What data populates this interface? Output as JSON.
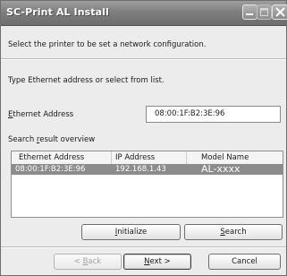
{
  "window": {
    "title": "SC-Print AL Install"
  },
  "titlebar_buttons": {
    "minimize_icon": "minimize-icon",
    "maximize_icon": "maximize-icon",
    "close_icon": "close-icon"
  },
  "instructions": {
    "line1": "Select the printer to be set a network configuration.",
    "line2": "Type Ethernet address or select from list."
  },
  "ethernet": {
    "label_prefix": "",
    "label_mnemonic": "E",
    "label_rest": "thernet Address",
    "value": "08:00:1F:B2:3E:96"
  },
  "search_result": {
    "label_prefix": "Search ",
    "label_mnemonic": "r",
    "label_rest": "esult overview",
    "columns": [
      "Ethernet Address",
      "IP Address",
      "Model Name"
    ],
    "rows": [
      {
        "ethernet": "08:00:1F:B2:3E:96",
        "ip": "192.168.1.43",
        "model": "AL-xxxx",
        "selected": true
      }
    ]
  },
  "actions": {
    "initialize": {
      "mnemonic": "I",
      "rest": "nitialize"
    },
    "search": {
      "mnemonic": "S",
      "rest": "earch"
    }
  },
  "footer": {
    "back": {
      "prefix": "< ",
      "mnemonic": "B",
      "rest": "ack"
    },
    "next": {
      "mnemonic": "N",
      "rest": "ext >"
    },
    "cancel": "Cancel"
  },
  "colors": {
    "titlebar": "#7f7f7f",
    "selected_row": "#8c8c8c",
    "dialog_bg": "#ececec"
  }
}
